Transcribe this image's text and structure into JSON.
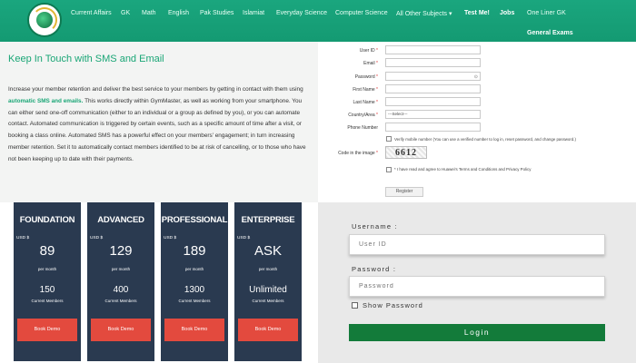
{
  "nav": {
    "items": [
      "Current Affairs",
      "GK",
      "Math",
      "English",
      "Pak Studies",
      "Islamiat",
      "Everyday Science",
      "Computer Science",
      "All Other Subjects",
      "Test Me!",
      "Jobs",
      "One Liner GK"
    ],
    "dropdown_caret": "▾",
    "second_row": "General Exams",
    "colors": {
      "bar": "#1aa67e",
      "link": "#eafff5"
    }
  },
  "sms": {
    "title": "Keep In Touch with SMS and Email",
    "body_pre": "Increase your member retention and deliver the best service to your members by getting in contact with them using ",
    "body_highlight": "automatic SMS and emails.",
    "body_post": " This works directly within GymMaster, as well as working from your smartphone. You can either send one-off communication (either to an individual or a group as defined by you), or you can automate contact. Automated communication is triggered by certain events, such as a specific amount of time after a visit, or booking a class online. Automated SMS has a powerful effect on your members' engagement; in turn increasing member retention. Set it to automatically contact members identified to be at risk of cancelling, or to those who have not been keeping up to date with their payments.",
    "accent": "#1aa676"
  },
  "register": {
    "fields": [
      {
        "label": "User ID",
        "required": "*"
      },
      {
        "label": "Email",
        "required": "*"
      },
      {
        "label": "Password",
        "required": "*"
      },
      {
        "label": "First Name",
        "required": "*"
      },
      {
        "label": "Last Name",
        "required": "*"
      },
      {
        "label": "Country/Area",
        "required": "*",
        "value": "---Select---"
      },
      {
        "label": "Phone Number",
        "required": ""
      }
    ],
    "verify_note": "Verify mobile number (You can use a verified number to log in, reset password, and change password.)",
    "captcha_label": "Code in the image",
    "captcha_required": "*",
    "captcha_text": "6612",
    "terms_note": "I have read and agree to Huawei's Terms and Conditions and Privacy Policy",
    "terms_required": "*",
    "submit_label": "Register",
    "eye_icon": "eye-icon"
  },
  "pricing": {
    "currency": "USD $",
    "period": "per month",
    "members_label": "Current Members",
    "demo_label": "Book Demo",
    "plans": [
      {
        "name": "FOUNDATION",
        "price": "89",
        "members": "150"
      },
      {
        "name": "ADVANCED",
        "price": "129",
        "members": "400"
      },
      {
        "name": "PROFESSIONAL",
        "price": "189",
        "members": "1300"
      },
      {
        "name": "ENTERPRISE",
        "price": "ASK",
        "members": "Unlimited"
      }
    ],
    "colors": {
      "card": "#2a3a50",
      "button": "#e34a3e"
    }
  },
  "login": {
    "username_label": "Username :",
    "username_placeholder": "User ID",
    "password_label": "Password :",
    "password_placeholder": "Password",
    "show_password_label": "Show Password",
    "button_label": "Login",
    "colors": {
      "button": "#137b3a"
    }
  }
}
